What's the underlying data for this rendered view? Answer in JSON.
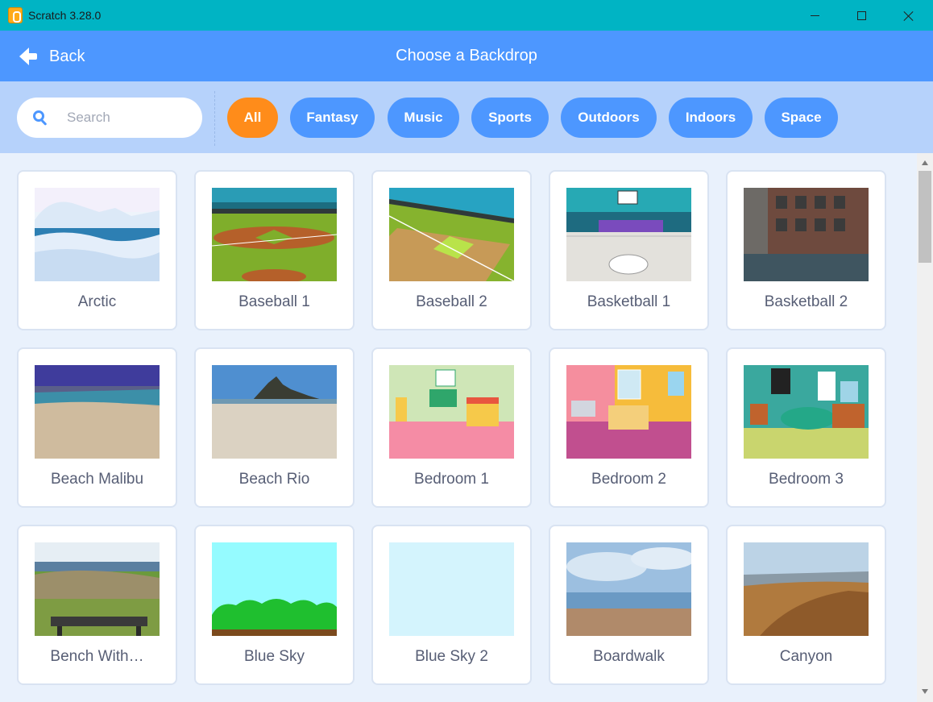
{
  "window": {
    "title": "Scratch 3.28.0"
  },
  "header": {
    "back_label": "Back",
    "title": "Choose a Backdrop"
  },
  "search": {
    "placeholder": "Search",
    "value": ""
  },
  "tags": [
    "All",
    "Fantasy",
    "Music",
    "Sports",
    "Outdoors",
    "Indoors",
    "Space"
  ],
  "active_tag": "All",
  "backdrops": [
    {
      "name": "Arctic",
      "thumb": "arctic"
    },
    {
      "name": "Baseball 1",
      "thumb": "baseball1"
    },
    {
      "name": "Baseball 2",
      "thumb": "baseball2"
    },
    {
      "name": "Basketball 1",
      "thumb": "basketball1"
    },
    {
      "name": "Basketball 2",
      "thumb": "basketball2"
    },
    {
      "name": "Beach Malibu",
      "thumb": "beach-malibu"
    },
    {
      "name": "Beach Rio",
      "thumb": "beach-rio"
    },
    {
      "name": "Bedroom 1",
      "thumb": "bedroom1"
    },
    {
      "name": "Bedroom 2",
      "thumb": "bedroom2"
    },
    {
      "name": "Bedroom 3",
      "thumb": "bedroom3"
    },
    {
      "name": "Bench With…",
      "thumb": "bench"
    },
    {
      "name": "Blue Sky",
      "thumb": "blue-sky"
    },
    {
      "name": "Blue Sky 2",
      "thumb": "blue-sky-2"
    },
    {
      "name": "Boardwalk",
      "thumb": "boardwalk"
    },
    {
      "name": "Canyon",
      "thumb": "canyon"
    }
  ],
  "colors": {
    "header": "#4d97ff",
    "filterbar": "#b6d2fb",
    "active_tag": "#ff8c1a",
    "tag": "#4d97ff",
    "titlebar": "#00b4c4"
  }
}
